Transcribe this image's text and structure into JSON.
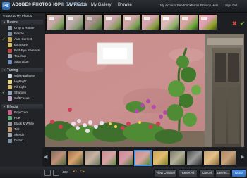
{
  "header": {
    "brand": "ADOBE® PHOTOSHOP®",
    "brand_edition": "EXPRESS",
    "nav": [
      "My Photos",
      "My Gallery",
      "Browse"
    ],
    "account_links": [
      "My Account",
      "Feedback",
      "Terms",
      "Privacy",
      "Help",
      "Sign Out"
    ]
  },
  "sidebar": {
    "back_label": "Back to My Photos",
    "sections": [
      {
        "label": "Basics",
        "items": [
          {
            "label": "Crop & Rotate",
            "checked": false
          },
          {
            "label": "Resize",
            "checked": false
          },
          {
            "label": "Auto Correct",
            "checked": true
          },
          {
            "label": "Exposure",
            "checked": false
          },
          {
            "label": "Red-Eye Removal",
            "checked": false
          },
          {
            "label": "Touchup",
            "checked": false
          },
          {
            "label": "Saturation",
            "checked": false
          }
        ]
      },
      {
        "label": "Tuning",
        "items": [
          {
            "label": "White Balance",
            "checked": false
          },
          {
            "label": "Highlight",
            "checked": false
          },
          {
            "label": "Fill Light",
            "checked": false
          },
          {
            "label": "Sharpen",
            "checked": true
          },
          {
            "label": "Soft Focus",
            "checked": false
          }
        ]
      },
      {
        "label": "Effects",
        "items": [
          {
            "label": "Pop Color",
            "checked": false
          },
          {
            "label": "Hue",
            "checked": false
          },
          {
            "label": "Black & White",
            "checked": false
          },
          {
            "label": "Tint",
            "checked": false
          },
          {
            "label": "Sketch",
            "checked": false
          },
          {
            "label": "Distort",
            "checked": false
          }
        ]
      }
    ]
  },
  "toolbar": {
    "zoom": "43%",
    "view_original": "View Original",
    "reset_all": "Reset All",
    "cancel": "Cancel",
    "save_to": "Save to...",
    "done": "Done"
  },
  "colors": {
    "accent": "#3a8ee6",
    "check": "#9bc05a",
    "cancel_x": "#d94a3a",
    "ok_check": "#6fbf3a"
  },
  "icons": {
    "close": "✖",
    "ok": "✔",
    "check": "✔",
    "undo": "↶",
    "redo": "↷",
    "prev": "◀",
    "next": "▶"
  }
}
